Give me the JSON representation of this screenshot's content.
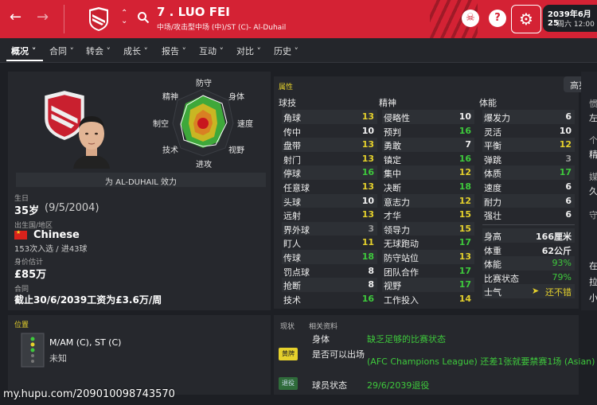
{
  "header": {
    "title": "7 . LUO FEI",
    "subtitle": "中场/攻击型中场 (中)/ST (C)- Al-Duhail",
    "date": "2039年6月25",
    "time": "周六 12:00"
  },
  "tabs": [
    "概况",
    "合同",
    "转会",
    "成长",
    "报告",
    "互动",
    "对比",
    "历史"
  ],
  "profile": {
    "plays_for": "为 AL-DUHAIL 效力",
    "radar_labels": [
      "防守",
      "身体",
      "速度",
      "视野",
      "进攻",
      "技术",
      "制空",
      "精神"
    ],
    "birth_label": "生日",
    "age": "35岁",
    "birth_date": "(9/5/2004)",
    "nation_label": "出生国/地区",
    "nation": "Chinese",
    "caps": "153次入选 / 进43球",
    "value_label": "身价估计",
    "value": "£85万",
    "contract_label": "合同",
    "contract": "截止30/6/2039工资为£3.6万/周"
  },
  "attributes": {
    "title": "属性",
    "highlight_button": "高亮显",
    "col_headers": [
      "球技",
      "精神",
      "体能"
    ],
    "technical": [
      {
        "name": "角球",
        "value": "13",
        "color": "yellow"
      },
      {
        "name": "传中",
        "value": "10",
        "color": "white"
      },
      {
        "name": "盘带",
        "value": "13",
        "color": "yellow"
      },
      {
        "name": "射门",
        "value": "13",
        "color": "yellow"
      },
      {
        "name": "停球",
        "value": "16",
        "color": "green"
      },
      {
        "name": "任意球",
        "value": "13",
        "color": "yellow"
      },
      {
        "name": "头球",
        "value": "10",
        "color": "white"
      },
      {
        "name": "远射",
        "value": "13",
        "color": "yellow"
      },
      {
        "name": "界外球",
        "value": "3",
        "color": "gray"
      },
      {
        "name": "盯人",
        "value": "11",
        "color": "yellow"
      },
      {
        "name": "传球",
        "value": "18",
        "color": "green"
      },
      {
        "name": "罚点球",
        "value": "8",
        "color": "white"
      },
      {
        "name": "抢断",
        "value": "8",
        "color": "white"
      },
      {
        "name": "技术",
        "value": "16",
        "color": "green"
      }
    ],
    "mental": [
      {
        "name": "侵略性",
        "value": "10",
        "color": "white"
      },
      {
        "name": "预判",
        "value": "16",
        "color": "green"
      },
      {
        "name": "勇敢",
        "value": "7",
        "color": "white"
      },
      {
        "name": "镇定",
        "value": "16",
        "color": "green"
      },
      {
        "name": "集中",
        "value": "12",
        "color": "yellow"
      },
      {
        "name": "决断",
        "value": "18",
        "color": "green"
      },
      {
        "name": "意志力",
        "value": "12",
        "color": "yellow"
      },
      {
        "name": "才华",
        "value": "15",
        "color": "yellow"
      },
      {
        "name": "领导力",
        "value": "15",
        "color": "yellow"
      },
      {
        "name": "无球跑动",
        "value": "17",
        "color": "green"
      },
      {
        "name": "防守站位",
        "value": "13",
        "color": "yellow"
      },
      {
        "name": "团队合作",
        "value": "17",
        "color": "green"
      },
      {
        "name": "视野",
        "value": "17",
        "color": "green"
      },
      {
        "name": "工作投入",
        "value": "14",
        "color": "yellow"
      }
    ],
    "physical": [
      {
        "name": "爆发力",
        "value": "6",
        "color": "white"
      },
      {
        "name": "灵活",
        "value": "10",
        "color": "white"
      },
      {
        "name": "平衡",
        "value": "12",
        "color": "yellow"
      },
      {
        "name": "弹跳",
        "value": "3",
        "color": "gray"
      },
      {
        "name": "体质",
        "value": "17",
        "color": "green"
      },
      {
        "name": "速度",
        "value": "6",
        "color": "white"
      },
      {
        "name": "耐力",
        "value": "6",
        "color": "white"
      },
      {
        "name": "强壮",
        "value": "6",
        "color": "white"
      }
    ],
    "info": [
      {
        "name": "身高",
        "value": "166厘米"
      },
      {
        "name": "体重",
        "value": "62公斤"
      },
      {
        "name": "体能",
        "value": "93%"
      },
      {
        "name": "比赛状态",
        "value": "79%"
      },
      {
        "name": "士气",
        "value": "还不错"
      }
    ]
  },
  "right_edge": [
    "惯",
    "左",
    "个",
    "精",
    "媒",
    "久",
    "守",
    "在",
    "拉",
    "小"
  ],
  "position": {
    "title": "位置",
    "roles": "M/AM (C), ST (C)",
    "other": "未知"
  },
  "status": {
    "tab1": "现状",
    "tab2": "相关资料",
    "rows": [
      {
        "badge": "",
        "label": "身体",
        "value": "缺乏足够的比赛状态"
      },
      {
        "badge": "黄牌",
        "label": "是否可以出场",
        "value": "(AFC Champions League) 还差1张就要禁赛1场 (Asian)"
      },
      {
        "badge": "退役",
        "label": "球员状态",
        "value": "29/6/2039退役"
      }
    ]
  },
  "watermark": "my.hupu.com/209010098743570",
  "colors": {
    "header": "#d42234",
    "green": "#3ec93c",
    "yellow": "#e5d12c"
  }
}
